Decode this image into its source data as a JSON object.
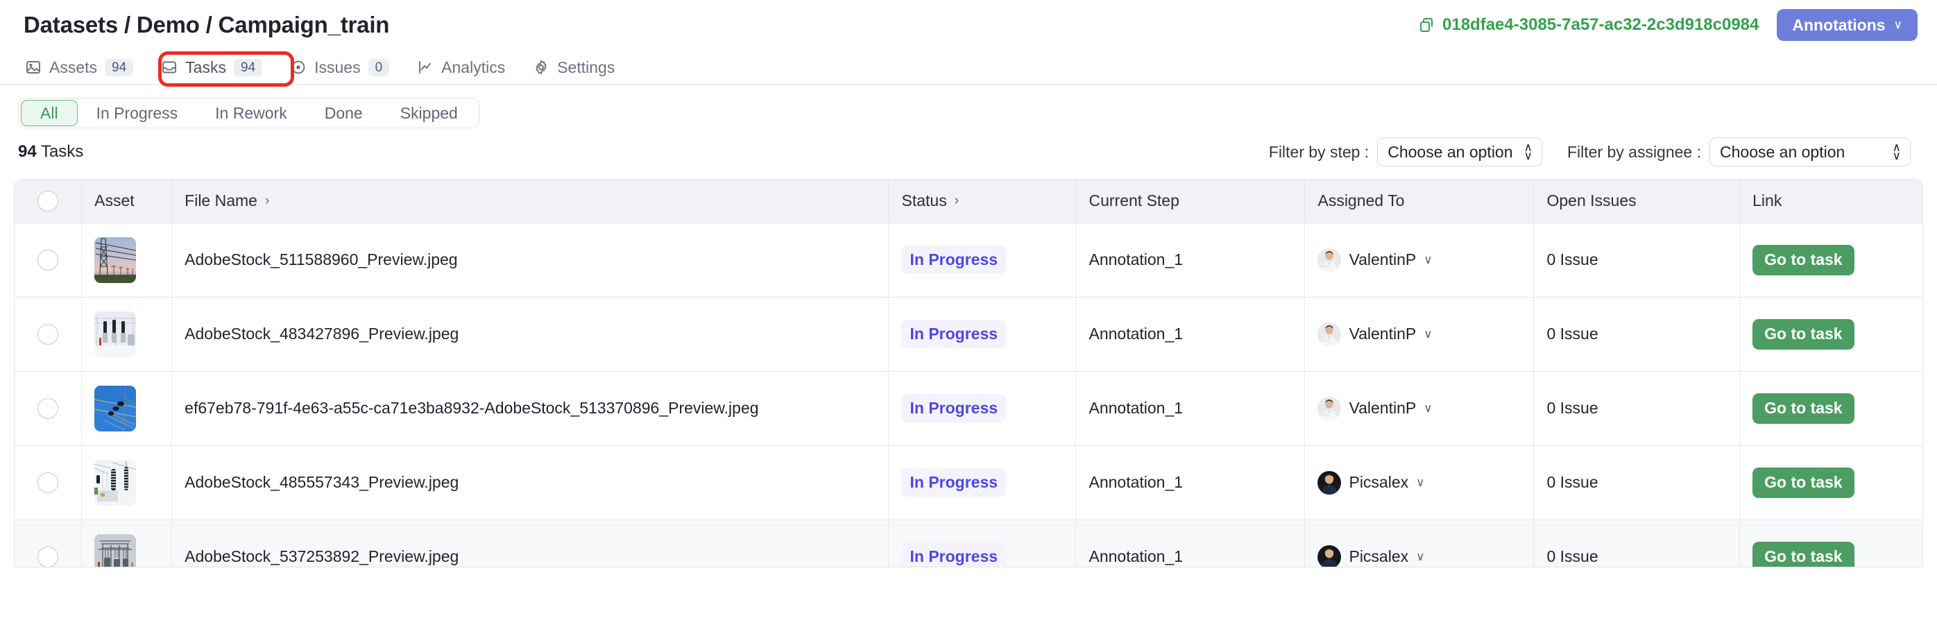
{
  "header": {
    "breadcrumb": "Datasets / Demo / Campaign_train",
    "dataset_id": "018dfae4-3085-7a57-ac32-2c3d918c0984",
    "annotations_label": "Annotations",
    "chevron": "∨"
  },
  "tabs": [
    {
      "label": "Assets",
      "count": "94",
      "icon": "image-icon",
      "active": false
    },
    {
      "label": "Tasks",
      "count": "94",
      "icon": "inbox-icon",
      "active": true
    },
    {
      "label": "Issues",
      "count": "0",
      "icon": "target-icon",
      "active": false
    },
    {
      "label": "Analytics",
      "count": null,
      "icon": "chart-line-icon",
      "active": false
    },
    {
      "label": "Settings",
      "count": null,
      "icon": "gear-icon",
      "active": false
    }
  ],
  "status_filters": [
    {
      "label": "All",
      "selected": true
    },
    {
      "label": "In Progress",
      "selected": false
    },
    {
      "label": "In Rework",
      "selected": false
    },
    {
      "label": "Done",
      "selected": false
    },
    {
      "label": "Skipped",
      "selected": false
    }
  ],
  "subbar": {
    "count": "94",
    "count_suffix": " Tasks",
    "filter_step_label": "Filter by step :",
    "filter_step_value": "Choose an option",
    "filter_assignee_label": "Filter by assignee :",
    "filter_assignee_value": "Choose an option"
  },
  "table": {
    "columns": [
      {
        "key": "check",
        "label": "",
        "sortable": false
      },
      {
        "key": "asset",
        "label": "Asset",
        "sortable": false
      },
      {
        "key": "file",
        "label": "File Name",
        "sortable": true
      },
      {
        "key": "status",
        "label": "Status",
        "sortable": true
      },
      {
        "key": "step",
        "label": "Current Step",
        "sortable": false
      },
      {
        "key": "assign",
        "label": "Assigned To",
        "sortable": false
      },
      {
        "key": "issues",
        "label": "Open Issues",
        "sortable": false
      },
      {
        "key": "link",
        "label": "Link",
        "sortable": false
      }
    ],
    "sort_chevron": "›",
    "go_label": "Go to task",
    "rows": [
      {
        "file": "AdobeStock_511588960_Preview.jpeg",
        "status": "In Progress",
        "step": "Annotation_1",
        "assignee": "ValentinP",
        "avatar": "light",
        "issues": "0 Issue",
        "thumb": "pylon-sunset"
      },
      {
        "file": "AdobeStock_483427896_Preview.jpeg",
        "status": "In Progress",
        "step": "Annotation_1",
        "assignee": "ValentinP",
        "avatar": "light",
        "issues": "0 Issue",
        "thumb": "substation-snow"
      },
      {
        "file": "ef67eb78-791f-4e63-a55c-ca71e3ba8932-AdobeStock_513370896_Preview.jpeg",
        "status": "In Progress",
        "step": "Annotation_1",
        "assignee": "ValentinP",
        "avatar": "light",
        "issues": "0 Issue",
        "thumb": "insulators-bluesky"
      },
      {
        "file": "AdobeStock_485557343_Preview.jpeg",
        "status": "In Progress",
        "step": "Annotation_1",
        "assignee": "Picsalex",
        "avatar": "dark",
        "issues": "0 Issue",
        "thumb": "transformer-white"
      },
      {
        "file": "AdobeStock_537253892_Preview.jpeg",
        "status": "In Progress",
        "step": "Annotation_1",
        "assignee": "Picsalex",
        "avatar": "dark",
        "issues": "0 Issue",
        "thumb": "substation-field"
      }
    ]
  },
  "colors": {
    "accent_green": "#35a14e",
    "button_green": "#4b9d61",
    "annotations_blue": "#6d7fdb",
    "status_indigo": "#4f46e5",
    "highlight_red": "#ef2b21"
  }
}
